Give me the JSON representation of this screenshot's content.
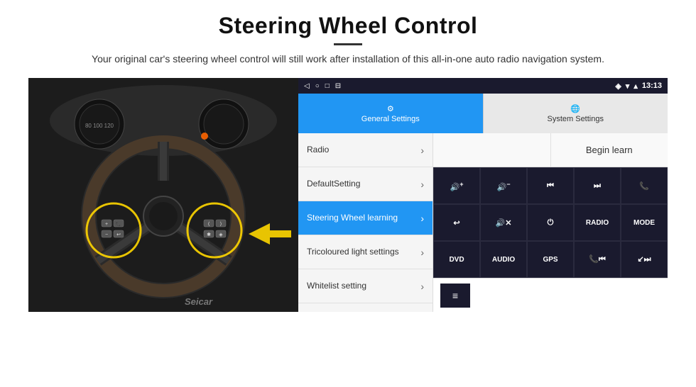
{
  "page": {
    "title": "Steering Wheel Control",
    "subtitle": "Your original car's steering wheel control will still work after installation of this all-in-one auto radio navigation system."
  },
  "status_bar": {
    "back_icon": "◁",
    "home_icon": "○",
    "square_icon": "□",
    "menu_icon": "⋮",
    "signal_icon": "▾▴",
    "wifi_icon": "▿",
    "time": "13:13"
  },
  "tabs": {
    "general_label": "General Settings",
    "system_label": "System Settings"
  },
  "menu": {
    "items": [
      {
        "label": "Radio",
        "active": false
      },
      {
        "label": "DefaultSetting",
        "active": false
      },
      {
        "label": "Steering Wheel learning",
        "active": true
      },
      {
        "label": "Tricoloured light settings",
        "active": false
      },
      {
        "label": "Whitelist setting",
        "active": false
      }
    ]
  },
  "content": {
    "begin_learn_label": "Begin learn",
    "buttons": [
      {
        "label": "🔊+",
        "type": "vol-up"
      },
      {
        "label": "🔊−",
        "type": "vol-down"
      },
      {
        "label": "⏮",
        "type": "prev"
      },
      {
        "label": "⏭",
        "type": "next"
      },
      {
        "label": "📞",
        "type": "call"
      },
      {
        "label": "↩",
        "type": "back"
      },
      {
        "label": "🔊✕",
        "type": "mute"
      },
      {
        "label": "⏻",
        "type": "power"
      },
      {
        "label": "RADIO",
        "type": "radio"
      },
      {
        "label": "MODE",
        "type": "mode"
      },
      {
        "label": "DVD",
        "type": "dvd"
      },
      {
        "label": "AUDIO",
        "type": "audio"
      },
      {
        "label": "GPS",
        "type": "gps"
      },
      {
        "label": "📞⏮",
        "type": "call-prev"
      },
      {
        "label": "↙⏭",
        "type": "call-next"
      }
    ],
    "bottom_icon": "≡"
  }
}
